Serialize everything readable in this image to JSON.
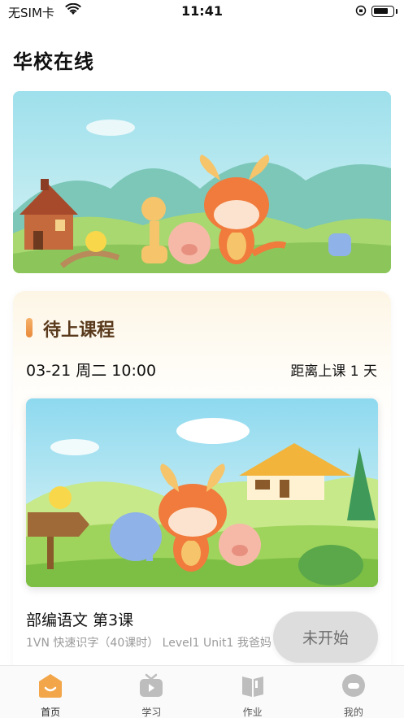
{
  "status_bar": {
    "carrier": "无SIM卡",
    "time": "11:41",
    "battery_level": 0.8
  },
  "app_title": "华校在线",
  "upcoming": {
    "title": "待上课程",
    "datetime": "03-21 周二 10:00",
    "countdown": "距离上课 1 天",
    "lesson_name": "部编语文 第3课",
    "lesson_detail": "1VN 快速识字（40课时） Level1 Unit1 我爸妈",
    "status_label": "未开始"
  },
  "tabs": [
    {
      "label": "首页",
      "icon": "home-icon",
      "active": true
    },
    {
      "label": "学习",
      "icon": "tv-icon",
      "active": false
    },
    {
      "label": "作业",
      "icon": "book-icon",
      "active": false
    },
    {
      "label": "我的",
      "icon": "profile-icon",
      "active": false
    }
  ],
  "colors": {
    "accent": "#f2a649",
    "title_brown": "#5a3a1c",
    "tab_inactive": "#bdbdbd"
  }
}
